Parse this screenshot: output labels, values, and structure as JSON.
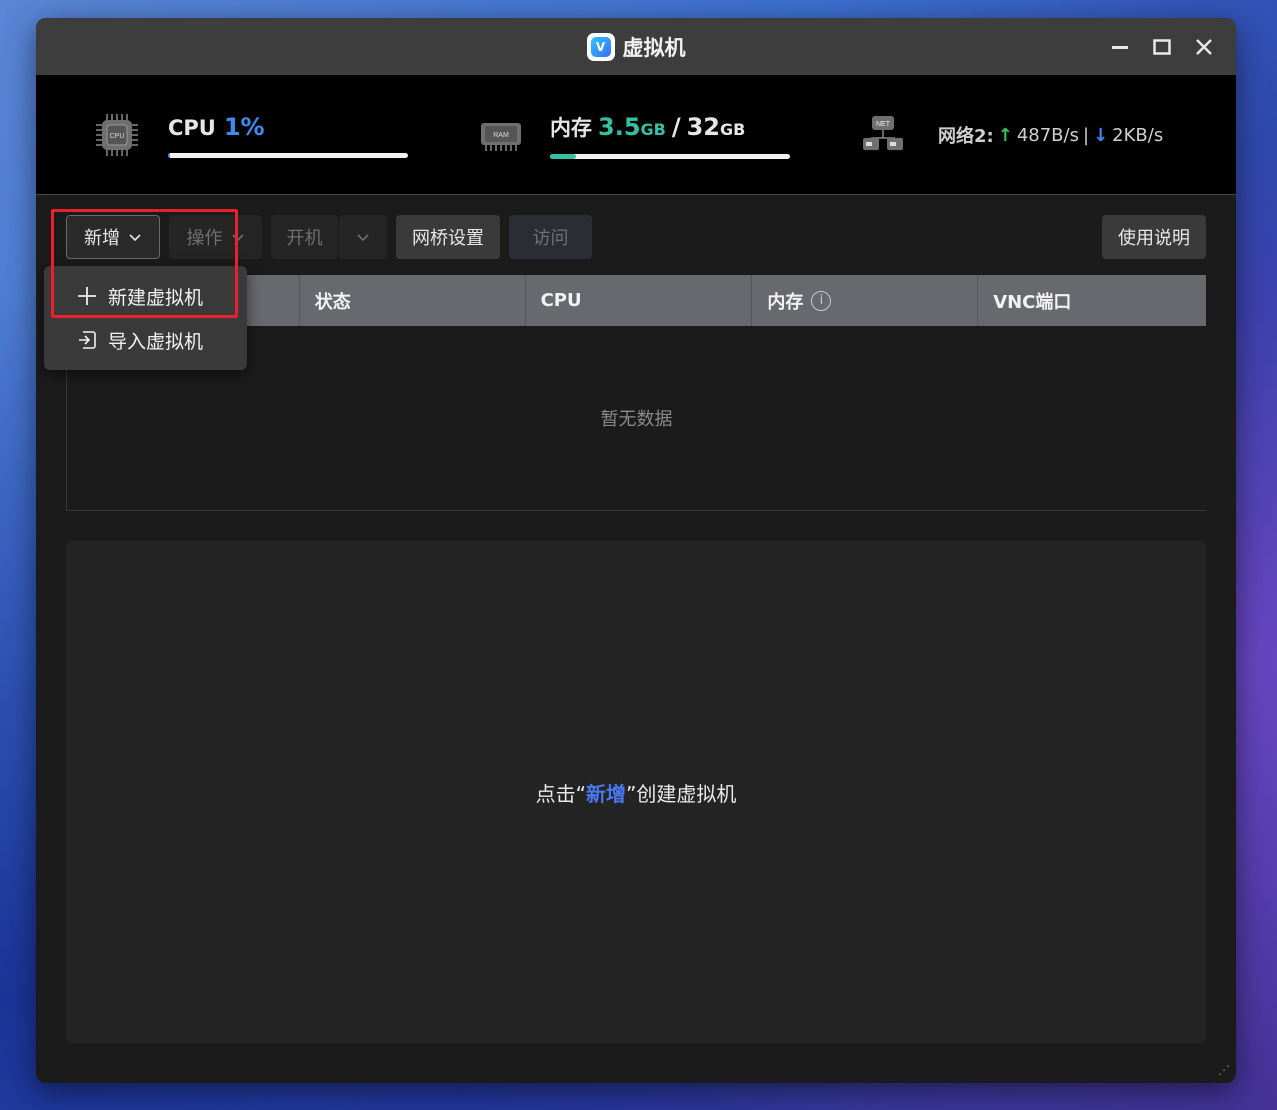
{
  "window": {
    "title": "虚拟机",
    "app_icon_letter": "V"
  },
  "monitor": {
    "cpu": {
      "label": "CPU",
      "value": "1%",
      "usage_fraction": 0.01
    },
    "memory": {
      "label": "内存",
      "used": "3.5",
      "used_unit": "GB",
      "sep": "/",
      "total": "32",
      "total_unit": "GB",
      "usage_fraction": 0.11
    },
    "network": {
      "label": "网络2:",
      "up_arrow": "↑",
      "up": "487B/s",
      "sep": "|",
      "down_arrow": "↓",
      "down": "2KB/s"
    },
    "icon_labels": {
      "cpu": "CPU",
      "ram": "RAM",
      "net": "NET"
    }
  },
  "toolbar": {
    "add_label": "新增",
    "operate_label": "操作",
    "power_on_label": "开机",
    "bridge_label": "网桥设置",
    "visit_label": "访问",
    "help_label": "使用说明"
  },
  "dropdown": {
    "items": [
      {
        "label": "新建虚拟机",
        "icon": "plus-icon"
      },
      {
        "label": "导入虚拟机",
        "icon": "import-icon"
      }
    ]
  },
  "table": {
    "columns": [
      "状态",
      "CPU",
      "内存",
      "VNC端口"
    ],
    "empty_text": "暂无数据"
  },
  "hint": {
    "before": "点击",
    "quote_open": "“",
    "highlight": "新增",
    "quote_close": "”",
    "after": "创建虚拟机"
  },
  "colors": {
    "accent_blue": "#3d8bf0",
    "memory_green": "#35c0a4",
    "net_up_green": "#2fc55a",
    "highlight_box_red": "#e8212b"
  }
}
